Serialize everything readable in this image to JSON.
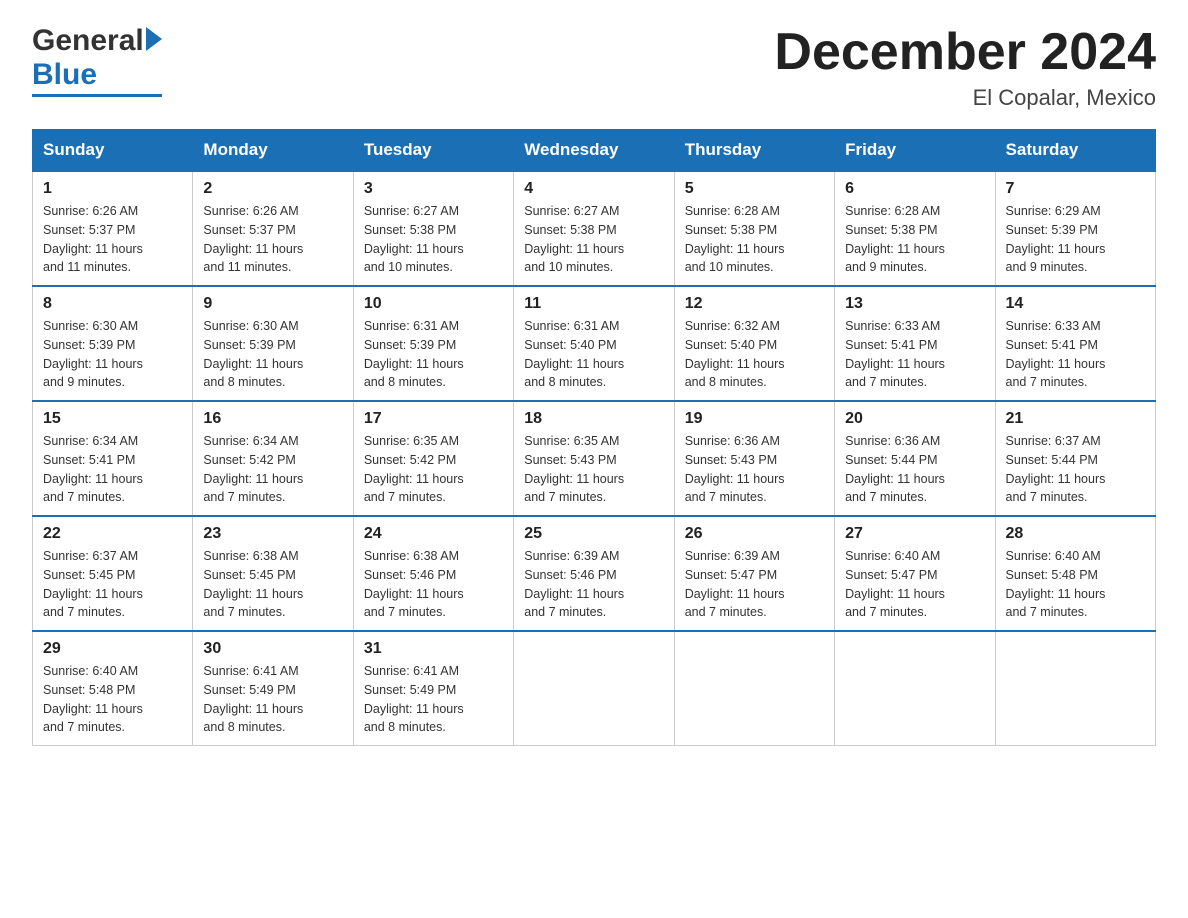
{
  "header": {
    "month_title": "December 2024",
    "location": "El Copalar, Mexico",
    "logo_general": "General",
    "logo_blue": "Blue"
  },
  "days_of_week": [
    "Sunday",
    "Monday",
    "Tuesday",
    "Wednesday",
    "Thursday",
    "Friday",
    "Saturday"
  ],
  "weeks": [
    [
      {
        "num": "1",
        "sunrise": "6:26 AM",
        "sunset": "5:37 PM",
        "daylight": "11 hours and 11 minutes."
      },
      {
        "num": "2",
        "sunrise": "6:26 AM",
        "sunset": "5:37 PM",
        "daylight": "11 hours and 11 minutes."
      },
      {
        "num": "3",
        "sunrise": "6:27 AM",
        "sunset": "5:38 PM",
        "daylight": "11 hours and 10 minutes."
      },
      {
        "num": "4",
        "sunrise": "6:27 AM",
        "sunset": "5:38 PM",
        "daylight": "11 hours and 10 minutes."
      },
      {
        "num": "5",
        "sunrise": "6:28 AM",
        "sunset": "5:38 PM",
        "daylight": "11 hours and 10 minutes."
      },
      {
        "num": "6",
        "sunrise": "6:28 AM",
        "sunset": "5:38 PM",
        "daylight": "11 hours and 9 minutes."
      },
      {
        "num": "7",
        "sunrise": "6:29 AM",
        "sunset": "5:39 PM",
        "daylight": "11 hours and 9 minutes."
      }
    ],
    [
      {
        "num": "8",
        "sunrise": "6:30 AM",
        "sunset": "5:39 PM",
        "daylight": "11 hours and 9 minutes."
      },
      {
        "num": "9",
        "sunrise": "6:30 AM",
        "sunset": "5:39 PM",
        "daylight": "11 hours and 8 minutes."
      },
      {
        "num": "10",
        "sunrise": "6:31 AM",
        "sunset": "5:39 PM",
        "daylight": "11 hours and 8 minutes."
      },
      {
        "num": "11",
        "sunrise": "6:31 AM",
        "sunset": "5:40 PM",
        "daylight": "11 hours and 8 minutes."
      },
      {
        "num": "12",
        "sunrise": "6:32 AM",
        "sunset": "5:40 PM",
        "daylight": "11 hours and 8 minutes."
      },
      {
        "num": "13",
        "sunrise": "6:33 AM",
        "sunset": "5:41 PM",
        "daylight": "11 hours and 7 minutes."
      },
      {
        "num": "14",
        "sunrise": "6:33 AM",
        "sunset": "5:41 PM",
        "daylight": "11 hours and 7 minutes."
      }
    ],
    [
      {
        "num": "15",
        "sunrise": "6:34 AM",
        "sunset": "5:41 PM",
        "daylight": "11 hours and 7 minutes."
      },
      {
        "num": "16",
        "sunrise": "6:34 AM",
        "sunset": "5:42 PM",
        "daylight": "11 hours and 7 minutes."
      },
      {
        "num": "17",
        "sunrise": "6:35 AM",
        "sunset": "5:42 PM",
        "daylight": "11 hours and 7 minutes."
      },
      {
        "num": "18",
        "sunrise": "6:35 AM",
        "sunset": "5:43 PM",
        "daylight": "11 hours and 7 minutes."
      },
      {
        "num": "19",
        "sunrise": "6:36 AM",
        "sunset": "5:43 PM",
        "daylight": "11 hours and 7 minutes."
      },
      {
        "num": "20",
        "sunrise": "6:36 AM",
        "sunset": "5:44 PM",
        "daylight": "11 hours and 7 minutes."
      },
      {
        "num": "21",
        "sunrise": "6:37 AM",
        "sunset": "5:44 PM",
        "daylight": "11 hours and 7 minutes."
      }
    ],
    [
      {
        "num": "22",
        "sunrise": "6:37 AM",
        "sunset": "5:45 PM",
        "daylight": "11 hours and 7 minutes."
      },
      {
        "num": "23",
        "sunrise": "6:38 AM",
        "sunset": "5:45 PM",
        "daylight": "11 hours and 7 minutes."
      },
      {
        "num": "24",
        "sunrise": "6:38 AM",
        "sunset": "5:46 PM",
        "daylight": "11 hours and 7 minutes."
      },
      {
        "num": "25",
        "sunrise": "6:39 AM",
        "sunset": "5:46 PM",
        "daylight": "11 hours and 7 minutes."
      },
      {
        "num": "26",
        "sunrise": "6:39 AM",
        "sunset": "5:47 PM",
        "daylight": "11 hours and 7 minutes."
      },
      {
        "num": "27",
        "sunrise": "6:40 AM",
        "sunset": "5:47 PM",
        "daylight": "11 hours and 7 minutes."
      },
      {
        "num": "28",
        "sunrise": "6:40 AM",
        "sunset": "5:48 PM",
        "daylight": "11 hours and 7 minutes."
      }
    ],
    [
      {
        "num": "29",
        "sunrise": "6:40 AM",
        "sunset": "5:48 PM",
        "daylight": "11 hours and 7 minutes."
      },
      {
        "num": "30",
        "sunrise": "6:41 AM",
        "sunset": "5:49 PM",
        "daylight": "11 hours and 8 minutes."
      },
      {
        "num": "31",
        "sunrise": "6:41 AM",
        "sunset": "5:49 PM",
        "daylight": "11 hours and 8 minutes."
      },
      null,
      null,
      null,
      null
    ]
  ],
  "labels": {
    "sunrise_prefix": "Sunrise: ",
    "sunset_prefix": "Sunset: ",
    "daylight_prefix": "Daylight: "
  }
}
